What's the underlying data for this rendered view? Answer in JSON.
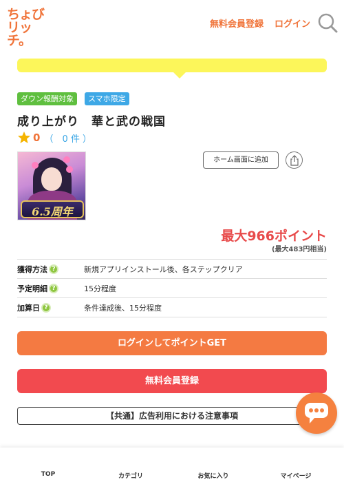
{
  "header": {
    "logo_line1": "ちょび",
    "logo_line2": "リッチ。",
    "register_link": "無料会員登録",
    "login_link": "ログイン",
    "search_icon": "search-icon"
  },
  "tags": {
    "download": "ダウン報酬対象",
    "smartphone": "スマホ限定"
  },
  "title": "成り上がり　華と武の戦国",
  "rating": {
    "score": "0",
    "count": "（　0 件 ）"
  },
  "thumbnail": {
    "anniversary_text": "6.5周年"
  },
  "actions": {
    "home_screen": "ホーム画面に追加",
    "share_icon": "share-icon"
  },
  "points": {
    "max": "最大966ポイント",
    "yen": "(最大483円相当)"
  },
  "info": {
    "rows": [
      {
        "label": "獲得方法",
        "value": "新規アプリインストール後、各ステップクリア"
      },
      {
        "label": "予定明細",
        "value": "15分程度"
      },
      {
        "label": "加算日",
        "value": "条件達成後、15分程度"
      }
    ],
    "help_glyph": "?"
  },
  "buttons": {
    "login_get": "ログインしてポイントGET",
    "register": "無料会員登録"
  },
  "notice": "【共通】広告利用における注意事項",
  "bottom_nav": {
    "top": "TOP",
    "category": "カテゴリ",
    "favorites": "お気に入り",
    "mypage": "マイページ"
  },
  "colors": {
    "brand_orange": "#f0743a",
    "register_red": "#f24a4f",
    "banner_yellow": "#fcf65a",
    "tag_green": "#5fbf3f",
    "tag_blue": "#3ea8e6"
  }
}
